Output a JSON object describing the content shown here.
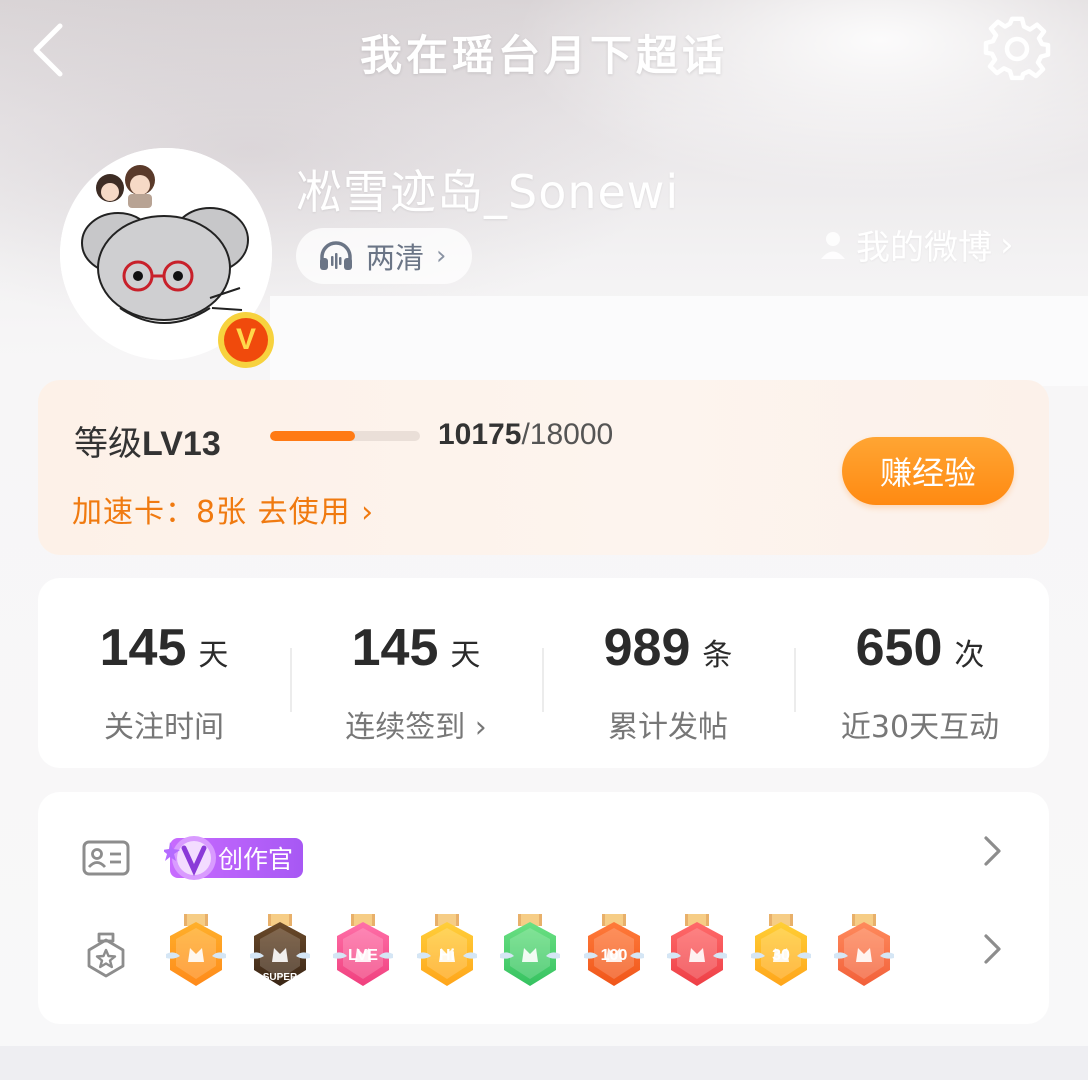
{
  "header": {
    "title": "我在瑶台月下超话",
    "back_icon": "chevron-left-icon",
    "settings_icon": "gear-icon"
  },
  "profile": {
    "username": "凇雪迹岛_Sonewi",
    "tag_label": "两清",
    "tag_icon": "headphones-icon",
    "tag_chevron": "›",
    "my_weibo_label": "我的微博",
    "my_weibo_chevron": "›",
    "verified_badge": "V"
  },
  "level": {
    "label": "等级",
    "value": "LV13",
    "exp_current": "10175",
    "exp_max": "/18000",
    "progress": 0.565,
    "boost_text": "加速卡：8张 去使用 ›",
    "earn_button": "赚经验",
    "accent_color": "#ff7a14"
  },
  "stats": [
    {
      "number": "145",
      "unit": "天",
      "label": "关注时间"
    },
    {
      "number": "145",
      "unit": "天",
      "label": "连续签到 ›"
    },
    {
      "number": "989",
      "unit": "条",
      "label": "累计发帖"
    },
    {
      "number": "650",
      "unit": "次",
      "label": "近30天互动"
    }
  ],
  "badges": {
    "identity_icon": "id-card-icon",
    "creator_label": "创作官",
    "medal_icon": "medal-star-icon",
    "chevron": "›",
    "medals": [
      {
        "name": "crown-medal",
        "colors": [
          "#ffb02a",
          "#ff8a1a"
        ],
        "text": ""
      },
      {
        "name": "super-medal",
        "colors": [
          "#6b4a2a",
          "#3a2616"
        ],
        "text": "SUPER"
      },
      {
        "name": "love-medal",
        "colors": [
          "#ff6fa8",
          "#f0407e"
        ],
        "text": "LVE"
      },
      {
        "name": "hi-medal",
        "colors": [
          "#ffcf3a",
          "#ffa51a"
        ],
        "text": "Hi"
      },
      {
        "name": "hand-medal",
        "colors": [
          "#6be083",
          "#35c260"
        ],
        "text": ""
      },
      {
        "name": "100-days-medal",
        "colors": [
          "#ff7a3a",
          "#f0561a"
        ],
        "text": "100"
      },
      {
        "name": "trophy-medal",
        "colors": [
          "#ff6a6a",
          "#ee3f46"
        ],
        "text": ""
      },
      {
        "name": "30-days-medal",
        "colors": [
          "#ffcf35",
          "#ffa51a"
        ],
        "text": "30"
      },
      {
        "name": "rock-hand-medal",
        "colors": [
          "#ff8a5c",
          "#f2603a"
        ],
        "text": ""
      }
    ]
  }
}
